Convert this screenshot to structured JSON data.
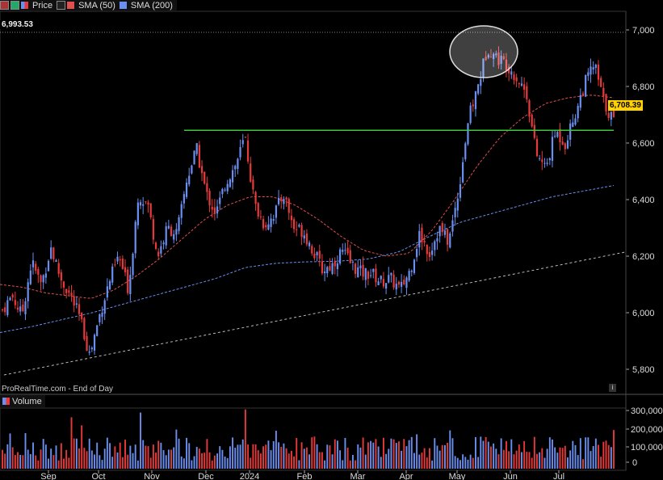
{
  "toolbar": {
    "price_label": "Price",
    "sma50_label": "SMA (50)",
    "sma200_label": "SMA (200)",
    "volume_label": "Volume",
    "colors": {
      "sma50": "#e05050",
      "sma200": "#6a8ff0",
      "support": "#3dc93d",
      "up": "#6a8ff0",
      "down": "#e83a3a"
    }
  },
  "readouts": {
    "top_value": "6,993.53",
    "last_price": "6,708.39"
  },
  "credit": "ProRealTime.com - End of Day",
  "chart_data": {
    "type": "candlestick",
    "price_axis": {
      "ticks": [
        "7,000",
        "6,800",
        "6,600",
        "6,400",
        "6,200",
        "6,000",
        "5,800"
      ],
      "ylim": [
        5750,
        7050
      ]
    },
    "volume_axis": {
      "ticks": [
        "300,000",
        "200,000",
        "100,000",
        "0"
      ]
    },
    "x_labels": [
      "Sep",
      "Oct",
      "Nov",
      "Dec",
      "2024",
      "Feb",
      "Mar",
      "Apr",
      "May",
      "Jun",
      "Jul"
    ],
    "grid": false,
    "annotations": {
      "support_level": 6645,
      "trendline_start": 5780,
      "trendline_end": 6215,
      "highlight": "circle around May highs"
    },
    "price_keypoints": [
      6010,
      6060,
      5990,
      6180,
      6100,
      6230,
      6120,
      6060,
      5980,
      5850,
      5990,
      6110,
      6200,
      6080,
      6420,
      6380,
      6200,
      6300,
      6280,
      6470,
      6580,
      6420,
      6350,
      6460,
      6520,
      6620,
      6380,
      6310,
      6350,
      6420,
      6300,
      6290,
      6220,
      6150,
      6170,
      6220,
      6170,
      6140,
      6140,
      6110,
      6120,
      6080,
      6150,
      6280,
      6210,
      6300,
      6250,
      6430,
      6680,
      6800,
      6940,
      6900,
      6880,
      6830,
      6780,
      6560,
      6510,
      6640,
      6600,
      6700,
      6810,
      6880,
      6740,
      6680
    ],
    "sma50_keypoints": [
      6100,
      6090,
      6070,
      6060,
      6050,
      6080,
      6130,
      6190,
      6260,
      6330,
      6380,
      6410,
      6410,
      6380,
      6330,
      6270,
      6220,
      6200,
      6210,
      6290,
      6400,
      6520,
      6620,
      6690,
      6740,
      6760,
      6770,
      6760
    ],
    "sma200_keypoints": [
      5930,
      5950,
      5975,
      6000,
      6030,
      6060,
      6090,
      6120,
      6160,
      6175,
      6180,
      6182,
      6190,
      6215,
      6270,
      6320,
      6350,
      6380,
      6410,
      6430,
      6450
    ]
  }
}
